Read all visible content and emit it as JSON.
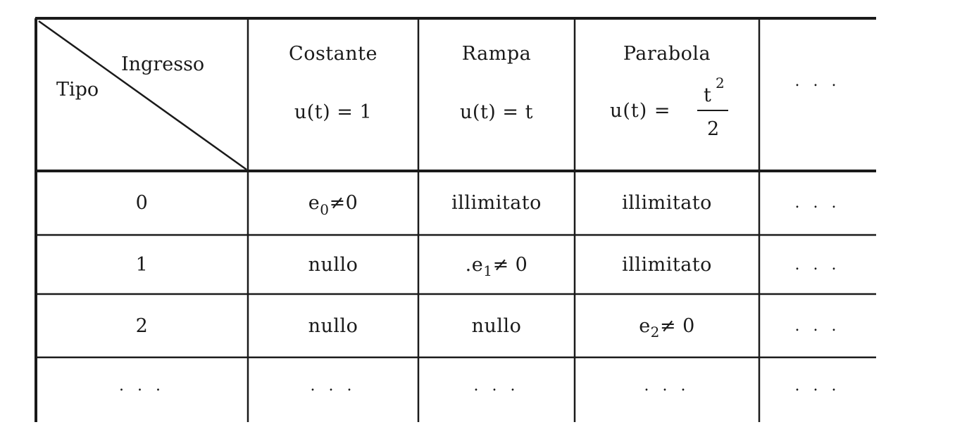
{
  "table": {
    "header": {
      "corner": {
        "top_label": "Ingresso",
        "bottom_label": "Tipo"
      },
      "columns": [
        {
          "title": "Costante",
          "formula": "u(t) = 1"
        },
        {
          "title": "Rampa",
          "formula": "u(t) = t"
        },
        {
          "title": "Parabola",
          "formula_lhs": "u(t) =",
          "num": "t",
          "num_exp": "2",
          "den": "2"
        },
        {
          "title": "",
          "ellipsis": ". . ."
        }
      ]
    },
    "rows": [
      {
        "tipo": "0",
        "costante": {
          "base": "e",
          "sub": "0",
          "rest": "≠0"
        },
        "rampa": "illimitato",
        "parabola": "illimitato",
        "more": ". . ."
      },
      {
        "tipo": "1",
        "costante": "nullo",
        "rampa": {
          "prefix": ".",
          "base": "e",
          "sub": "1",
          "rest": "≠ 0"
        },
        "parabola": "illimitato",
        "more": ". . ."
      },
      {
        "tipo": "2",
        "costante": "nullo",
        "rampa": "nullo",
        "parabola": {
          "base": "e",
          "sub": "2",
          "rest": "≠ 0"
        },
        "more": ". . ."
      },
      {
        "tipo": ". . .",
        "costante": ". . .",
        "rampa": ". . .",
        "parabola": ". . .",
        "more": ". . ."
      }
    ]
  }
}
